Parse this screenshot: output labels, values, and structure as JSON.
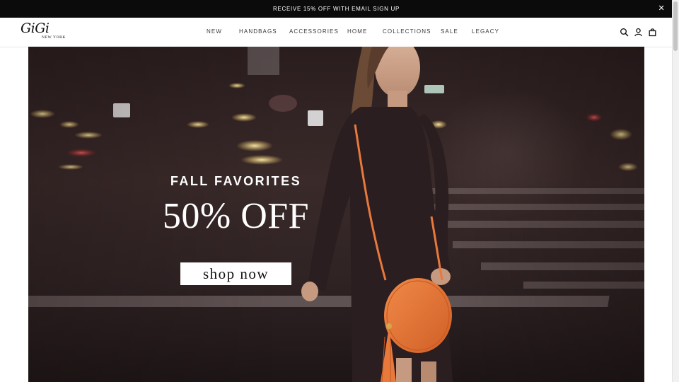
{
  "announcement": {
    "text": "RECEIVE 15% OFF WITH EMAIL SIGN UP",
    "close_icon": "close-icon"
  },
  "brand": {
    "name": "GiGi",
    "subtitle": "NEW YORK"
  },
  "nav": {
    "items": [
      "NEW",
      "HANDBAGS",
      "ACCESSORIES",
      "HOME",
      "COLLECTIONS",
      "SALE",
      "LEGACY"
    ]
  },
  "header_icons": [
    "search-icon",
    "account-icon",
    "cart-icon"
  ],
  "hero": {
    "kicker": "FALL FAVORITES",
    "title": "50% OFF",
    "cta": "shop now",
    "image": "woman-with-orange-round-crossbody-bag-night-street"
  },
  "colors": {
    "announcement_bg": "#0b0b0b",
    "bag_accent": "#e8793d",
    "text_dark": "#3a3a3a"
  }
}
